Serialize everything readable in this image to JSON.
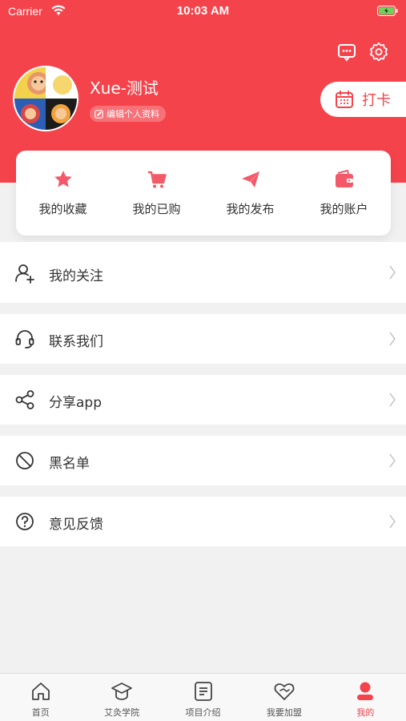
{
  "status_bar": {
    "carrier": "Carrier",
    "time": "10:03 AM"
  },
  "profile": {
    "username": "Xue-测试",
    "edit_label": "编辑个人资料",
    "checkin_label": "打卡"
  },
  "quick_actions": [
    {
      "label": "我的收藏",
      "icon": "star-icon"
    },
    {
      "label": "我的已购",
      "icon": "cart-icon"
    },
    {
      "label": "我的发布",
      "icon": "send-icon"
    },
    {
      "label": "我的账户",
      "icon": "wallet-icon"
    }
  ],
  "menu": [
    {
      "label": "我的关注",
      "icon": "user-add-icon"
    },
    {
      "label": "联系我们",
      "icon": "headset-icon"
    },
    {
      "label": "分享app",
      "icon": "share-icon"
    },
    {
      "label": "黑名单",
      "icon": "block-icon"
    },
    {
      "label": "意见反馈",
      "icon": "question-icon"
    }
  ],
  "tabbar": [
    {
      "label": "首页",
      "icon": "home-icon",
      "active": false
    },
    {
      "label": "艾灸学院",
      "icon": "graduation-cap-icon",
      "active": false
    },
    {
      "label": "项目介绍",
      "icon": "document-icon",
      "active": false
    },
    {
      "label": "我要加盟",
      "icon": "handshake-icon",
      "active": false
    },
    {
      "label": "我的",
      "icon": "profile-icon",
      "active": true
    }
  ],
  "colors": {
    "accent": "#f5434b",
    "background": "#f1f1f1",
    "text": "#333333"
  }
}
